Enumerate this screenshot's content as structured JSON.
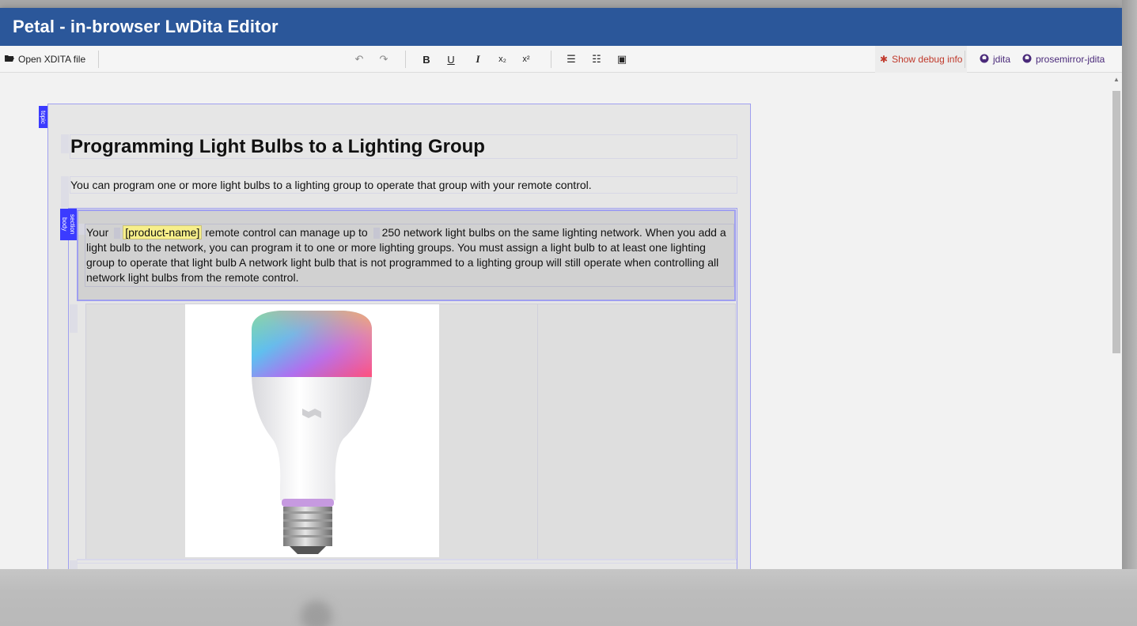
{
  "app": {
    "title": "Petal - in-browser LwDita Editor"
  },
  "toolbar": {
    "open_label": "Open XDITA file",
    "buttons": [
      {
        "name": "undo",
        "glyph": "↶"
      },
      {
        "name": "redo",
        "glyph": "↷"
      },
      {
        "name": "bold",
        "glyph": "B"
      },
      {
        "name": "underline",
        "glyph": "U"
      },
      {
        "name": "italic",
        "glyph": "I"
      },
      {
        "name": "subscript",
        "glyph": "x₂"
      },
      {
        "name": "superscript",
        "glyph": "x²"
      },
      {
        "name": "ordered-list",
        "glyph": "☰"
      },
      {
        "name": "unordered-list",
        "glyph": "☷"
      },
      {
        "name": "image",
        "glyph": "▣"
      }
    ],
    "debug_label": "Show debug info",
    "links": [
      "jdita",
      "prosemirror-jdita"
    ]
  },
  "editor": {
    "topic_tag": "topic",
    "body_tag_1": "section",
    "body_tag_2": "body",
    "title": "Programming Light Bulbs to a Lighting Group",
    "shortdesc": "You can program one or more light bulbs to a lighting group to operate that group with your remote control.",
    "para": {
      "part1": "Your ",
      "placeholder": "[product-name]",
      "part2": " remote control can manage up to ",
      "part3": "250 network light bulbs on the same lighting network. When you add a light bulb to the network, you can program it to one or more lighting groups. You must assign a light bulb to at least one lighting group to operate that light bulb A network light bulb that is not programmed to a lighting group will still operate when controlling all network light bulbs from the remote control."
    }
  },
  "colors": {
    "titlebar": "#2b579a",
    "tag": "#3b3bff",
    "debug": "#c0392b",
    "placeholder": "#f7ef8a"
  }
}
